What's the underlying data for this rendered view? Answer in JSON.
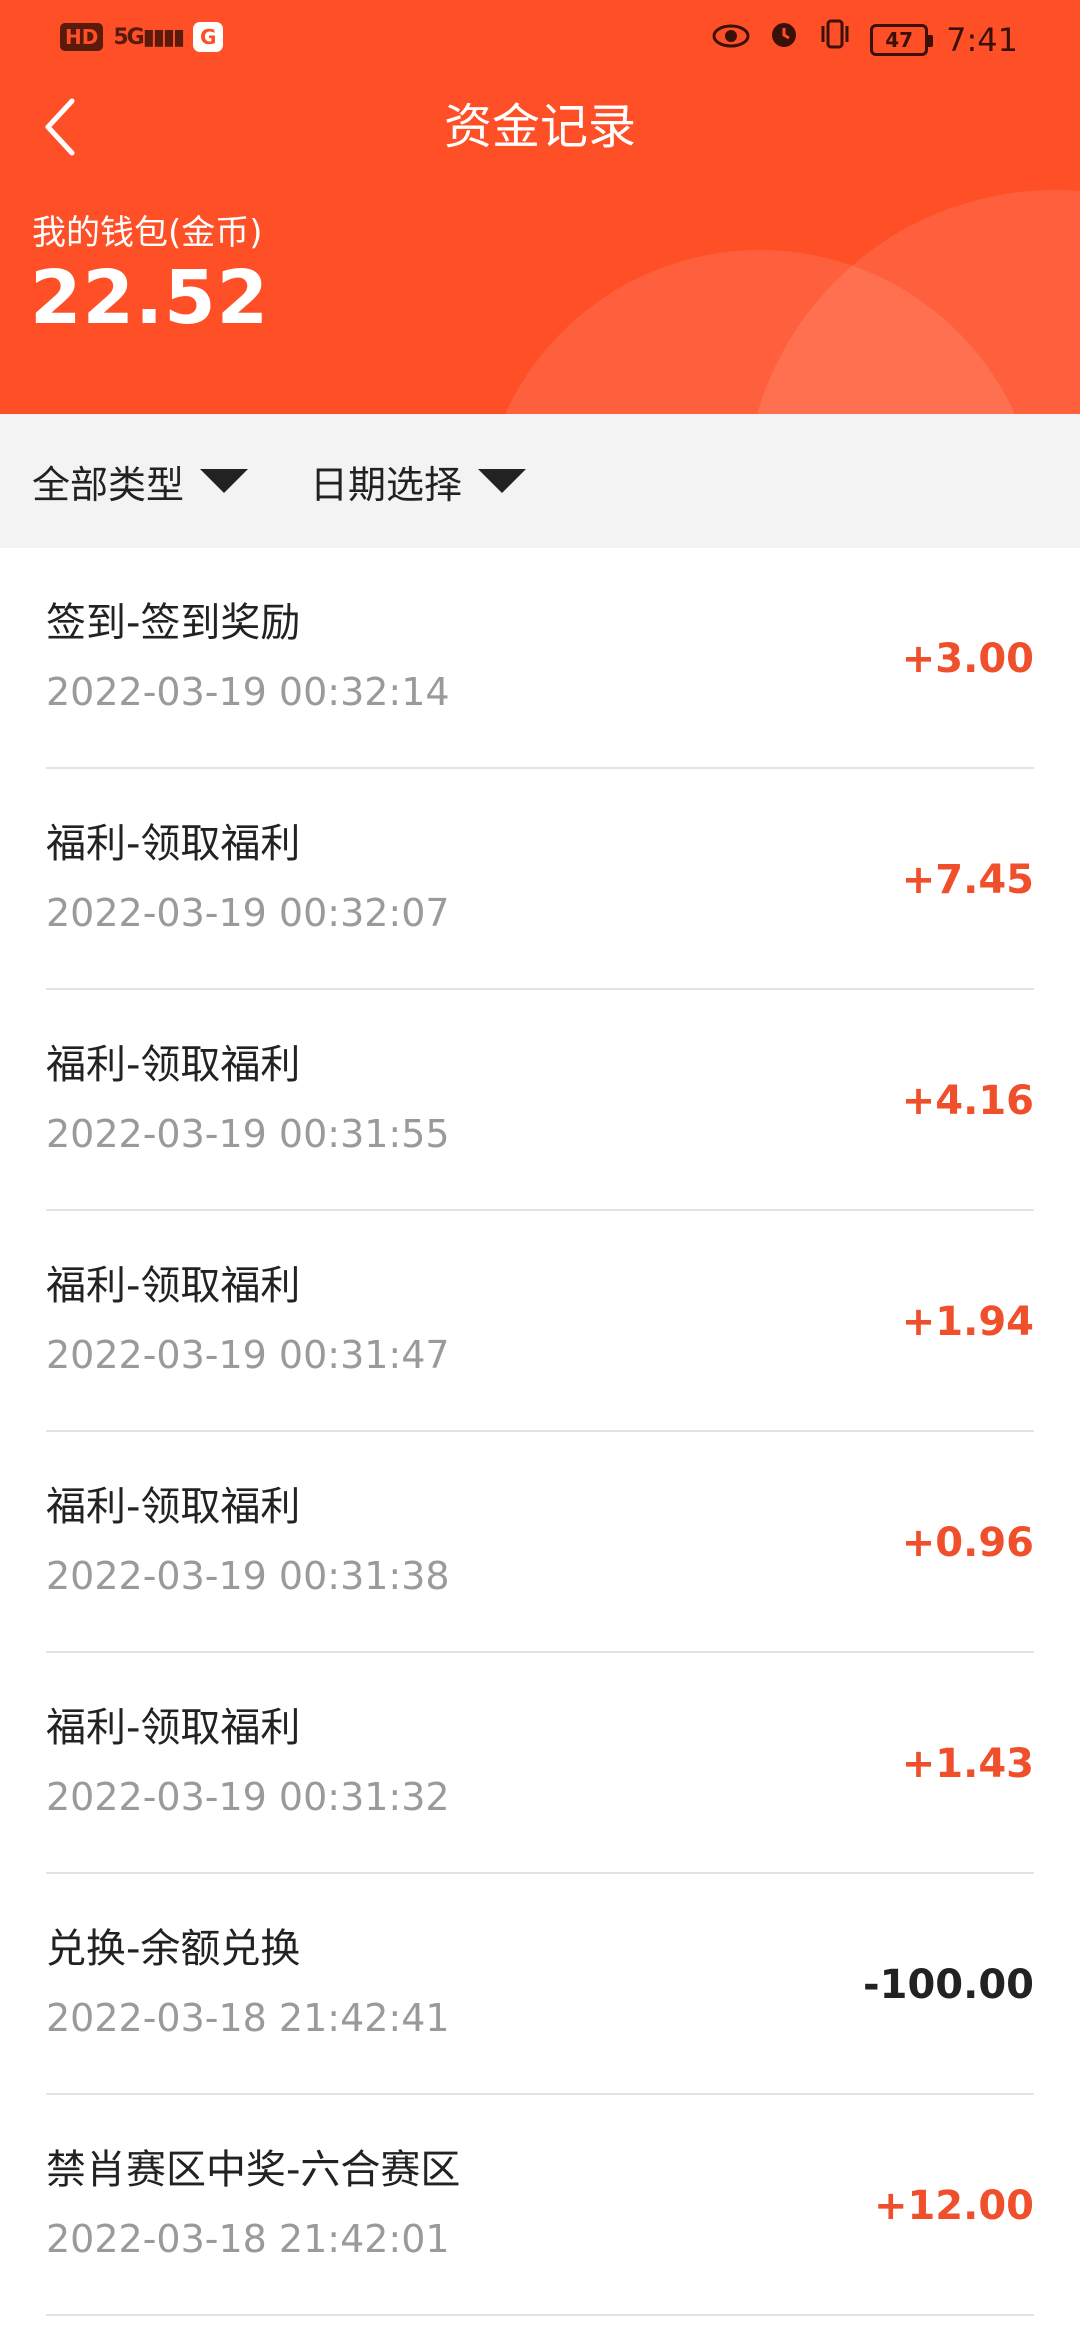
{
  "status_bar": {
    "hd": "HD",
    "signal": "5G",
    "app_badge": "G",
    "battery": "47",
    "time": "7:41",
    "icons": [
      "eye-icon",
      "alarm-icon",
      "vibrate-icon",
      "battery-icon"
    ]
  },
  "nav": {
    "back_icon": "chevron-left-icon",
    "title": "资金记录"
  },
  "wallet": {
    "label": "我的钱包(金币)",
    "amount": "22.52"
  },
  "filters": {
    "type_label": "全部类型",
    "date_label": "日期选择"
  },
  "colors": {
    "brand": "#fe4f27",
    "positive": "#ef4f2b",
    "negative": "#222222"
  },
  "records": [
    {
      "title": "签到-签到奖励",
      "time": "2022-03-19 00:32:14",
      "amount": "+3.00",
      "sign": "pos"
    },
    {
      "title": "福利-领取福利",
      "time": "2022-03-19 00:32:07",
      "amount": "+7.45",
      "sign": "pos"
    },
    {
      "title": "福利-领取福利",
      "time": "2022-03-19 00:31:55",
      "amount": "+4.16",
      "sign": "pos"
    },
    {
      "title": "福利-领取福利",
      "time": "2022-03-19 00:31:47",
      "amount": "+1.94",
      "sign": "pos"
    },
    {
      "title": "福利-领取福利",
      "time": "2022-03-19 00:31:38",
      "amount": "+0.96",
      "sign": "pos"
    },
    {
      "title": "福利-领取福利",
      "time": "2022-03-19 00:31:32",
      "amount": "+1.43",
      "sign": "pos"
    },
    {
      "title": "兑换-余额兑换",
      "time": "2022-03-18 21:42:41",
      "amount": "-100.00",
      "sign": "neg"
    },
    {
      "title": "禁肖赛区中奖-六合赛区",
      "time": "2022-03-18 21:42:01",
      "amount": "+12.00",
      "sign": "pos"
    }
  ]
}
